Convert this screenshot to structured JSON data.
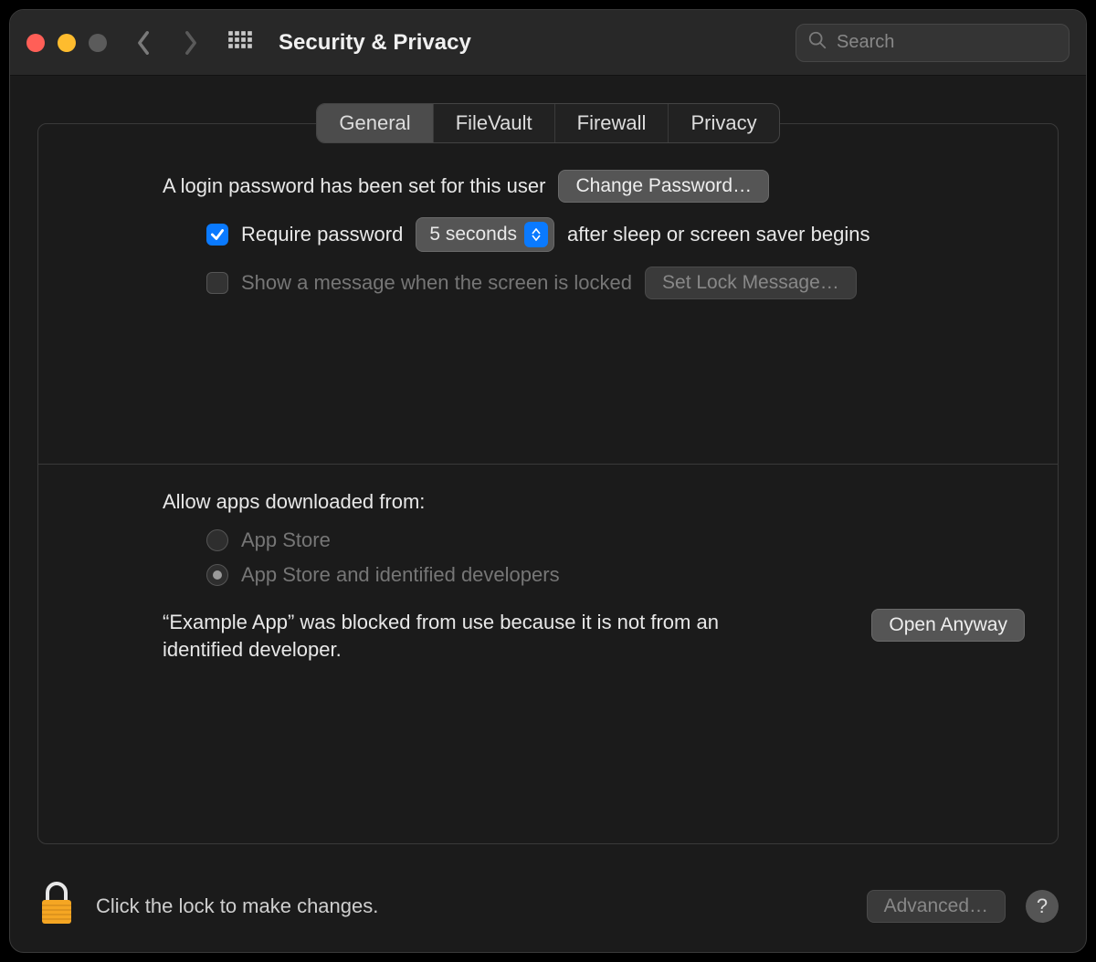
{
  "window": {
    "title": "Security & Privacy"
  },
  "search": {
    "placeholder": "Search"
  },
  "tabs": {
    "items": [
      {
        "label": "General",
        "active": true
      },
      {
        "label": "FileVault",
        "active": false
      },
      {
        "label": "Firewall",
        "active": false
      },
      {
        "label": "Privacy",
        "active": false
      }
    ]
  },
  "login": {
    "status_text": "A login password has been set for this user",
    "change_button": "Change Password…",
    "require_label_before": "Require password",
    "require_delay_selected": "5 seconds",
    "require_label_after": "after sleep or screen saver begins",
    "show_message_label": "Show a message when the screen is locked",
    "set_lock_message_button": "Set Lock Message…"
  },
  "allow": {
    "title": "Allow apps downloaded from:",
    "options": [
      {
        "label": "App Store",
        "selected": false
      },
      {
        "label": "App Store and identified developers",
        "selected": true
      }
    ]
  },
  "blocked": {
    "message": "“Example App” was blocked from use because it is not from an identified developer.",
    "open_button": "Open Anyway"
  },
  "footer": {
    "lock_text": "Click the lock to make changes.",
    "advanced_button": "Advanced…",
    "help_label": "?"
  }
}
